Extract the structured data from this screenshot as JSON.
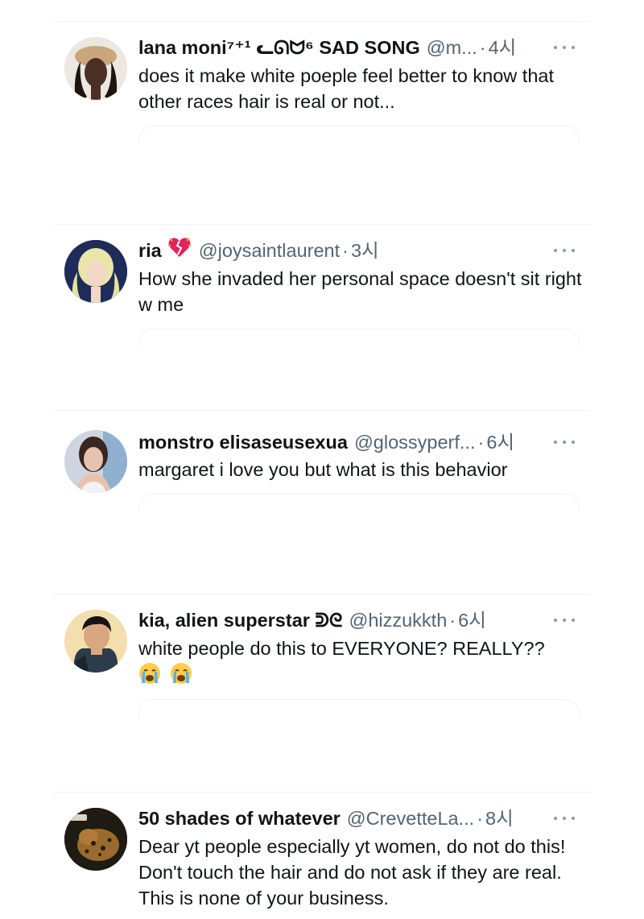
{
  "tweets": [
    {
      "display_name": "lana moni⁷⁺¹ ᓚᘏᗢ⁶ SAD SONG",
      "handle": "@m...",
      "time": "4시",
      "text": "does it make white poeple feel better to know that other races hair is real or not..."
    },
    {
      "display_name": "ria",
      "badge_icon": "broken-heart-emoji-icon",
      "handle": "@joysaintlaurent",
      "time": "3시",
      "text": "How she invaded her personal space doesn't sit right w me"
    },
    {
      "display_name": "monstro elisaseusexua",
      "handle": "@glossyperf...",
      "time": "6시",
      "text": "margaret i love you but what is this behavior"
    },
    {
      "display_name": "kia, alien superstar ᕲᘓ",
      "handle": "@hizzukkth",
      "time": "6시",
      "text": "white people do this to EVERYONE? REALLY??",
      "emoji_icons": [
        "crying-face-emoji-icon",
        "crying-face-emoji-icon"
      ]
    },
    {
      "display_name": "50 shades of whatever",
      "handle": "@CrevetteLa...",
      "time": "8시",
      "text": "Dear yt people especially yt women, do not do this! Don't touch the hair and do not ask if they are real.  This is none of your business."
    }
  ],
  "separator": "·",
  "colors": {
    "text": "#0f1419",
    "secondary": "#536471",
    "divider": "#eff3f4"
  }
}
